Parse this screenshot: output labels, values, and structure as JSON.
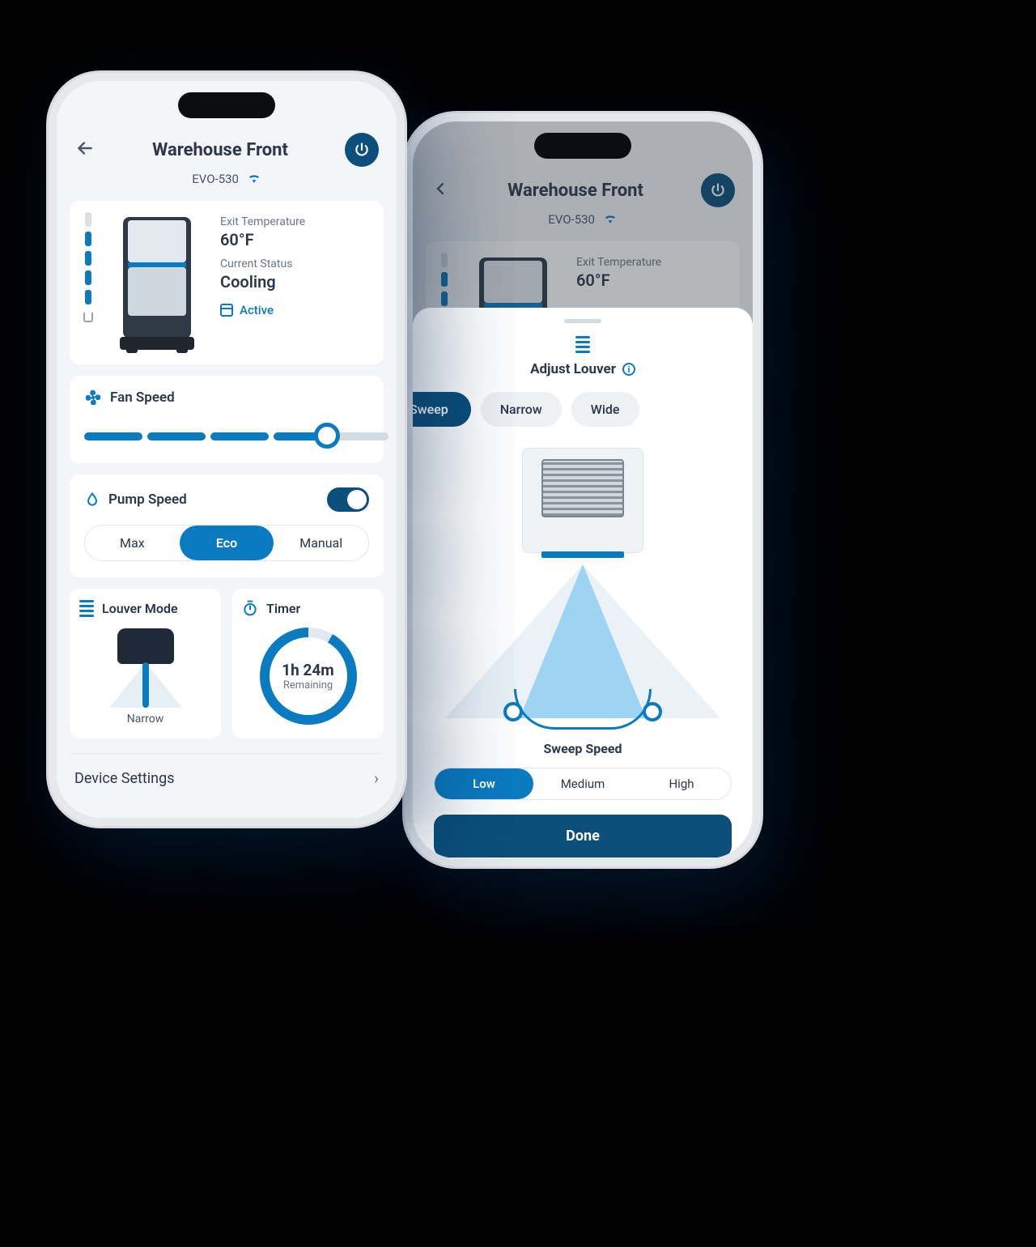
{
  "header": {
    "title": "Warehouse Front",
    "model": "EVO-530"
  },
  "status": {
    "exit_temp_label": "Exit Temperature",
    "exit_temp_value": "60°F",
    "status_label": "Current Status",
    "status_value": "Cooling",
    "active_label": "Active",
    "water_level_filled": 4,
    "water_level_total": 5
  },
  "fan": {
    "label": "Fan Speed",
    "level": 4,
    "max": 5
  },
  "pump": {
    "label": "Pump Speed",
    "enabled": true,
    "options": [
      "Max",
      "Eco",
      "Manual"
    ],
    "selected": "Eco"
  },
  "louver": {
    "label": "Louver Mode",
    "value": "Narrow"
  },
  "timer": {
    "label": "Timer",
    "value": "1h 24m",
    "sub": "Remaining"
  },
  "settings_label": "Device Settings",
  "sheet": {
    "title": "Adjust Louver",
    "modes": [
      "Sweep",
      "Narrow",
      "Wide"
    ],
    "mode_selected": "Sweep",
    "sweep_speed_label": "Sweep Speed",
    "sweep_speeds": [
      "Low",
      "Medium",
      "High"
    ],
    "sweep_selected": "Low",
    "done": "Done"
  }
}
